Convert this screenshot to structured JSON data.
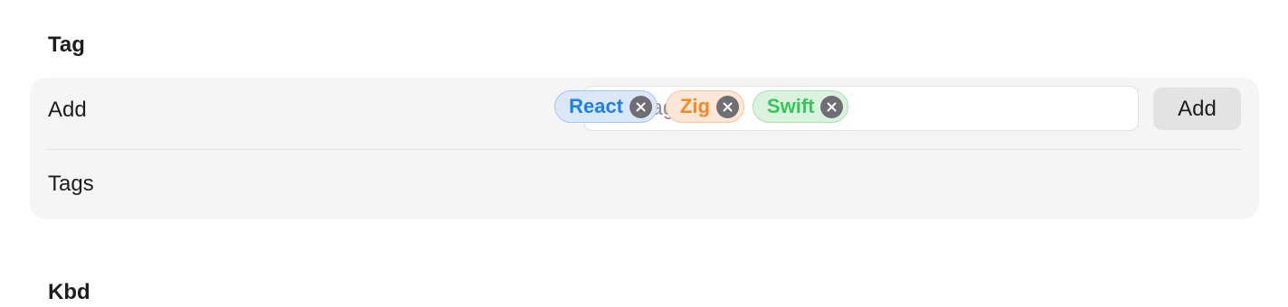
{
  "section": {
    "title": "Tag",
    "next_title": "Kbd"
  },
  "add_row": {
    "label": "Add",
    "input_placeholder": "New tag",
    "input_value": "",
    "button_label": "Add"
  },
  "tags_row": {
    "label": "Tags",
    "tags": [
      {
        "label": "React",
        "color": "#1a7ff0",
        "bg": "#dbe8fb",
        "border": "#a5c6f5"
      },
      {
        "label": "Zig",
        "color": "#f08a24",
        "bg": "#fbe6d7",
        "border": "#f5c6a0"
      },
      {
        "label": "Swift",
        "color": "#34c759",
        "bg": "#dbf2df",
        "border": "#a9e0b5"
      }
    ],
    "remove_icon": "close-circle-icon"
  },
  "colors": {
    "card_bg": "#f5f5f5",
    "divider": "#e2e2e2",
    "button_bg": "#e3e3e3",
    "remove_icon_bg": "#6e6e73"
  }
}
